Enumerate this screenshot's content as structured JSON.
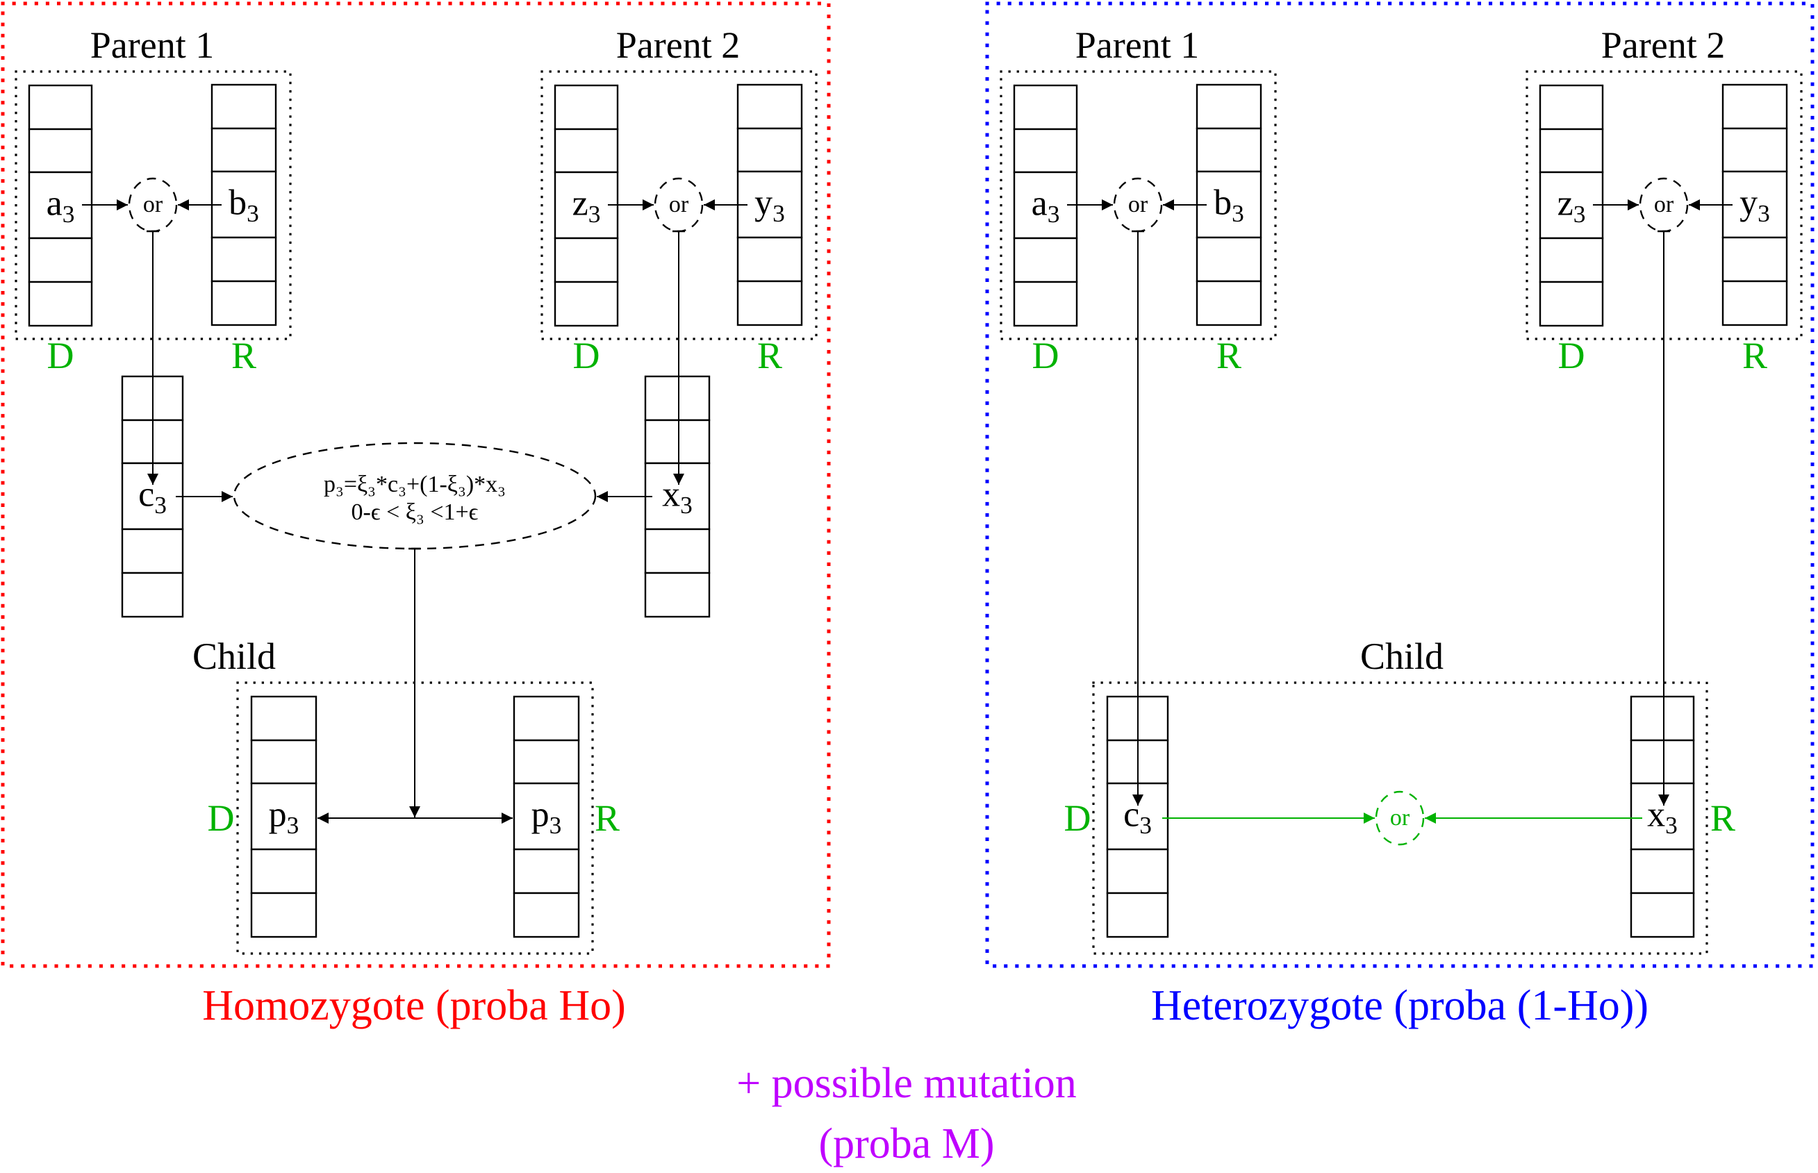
{
  "colors": {
    "homozygote": "#ff0000",
    "heterozygote": "#0000ff",
    "allele_label": "#00b200",
    "mutation": "#bf00ff",
    "ink": "#000000"
  },
  "panels": [
    {
      "id": "homozygote",
      "caption": "Homozygote (proba Ho)",
      "parents": [
        {
          "title": "Parent 1",
          "dominant": {
            "label": "D",
            "gene": "a",
            "sub": "3"
          },
          "recessive": {
            "label": "R",
            "gene": "b",
            "sub": "3"
          },
          "selector": "or"
        },
        {
          "title": "Parent 2",
          "dominant": {
            "label": "D",
            "gene": "z",
            "sub": "3"
          },
          "recessive": {
            "label": "R",
            "gene": "y",
            "sub": "3"
          },
          "selector": "or"
        }
      ],
      "gametes": [
        {
          "gene": "c",
          "sub": "3"
        },
        {
          "gene": "x",
          "sub": "3"
        }
      ],
      "blend": {
        "line1": "p₃=ξ₃*c₃+(1-ξ₃)*x₃",
        "line2": "0-ϵ < ξ₃ <1+ϵ"
      },
      "child": {
        "title": "Child",
        "dominant": {
          "label": "D",
          "gene": "p",
          "sub": "3"
        },
        "recessive": {
          "label": "R",
          "gene": "p",
          "sub": "3"
        }
      }
    },
    {
      "id": "heterozygote",
      "caption": "Heterozygote (proba (1-Ho))",
      "parents": [
        {
          "title": "Parent 1",
          "dominant": {
            "label": "D",
            "gene": "a",
            "sub": "3"
          },
          "recessive": {
            "label": "R",
            "gene": "b",
            "sub": "3"
          },
          "selector": "or"
        },
        {
          "title": "Parent 2",
          "dominant": {
            "label": "D",
            "gene": "z",
            "sub": "3"
          },
          "recessive": {
            "label": "R",
            "gene": "y",
            "sub": "3"
          },
          "selector": "or"
        }
      ],
      "child": {
        "title": "Child",
        "dominant": {
          "label": "D",
          "gene": "c",
          "sub": "3"
        },
        "recessive": {
          "label": "R",
          "gene": "x",
          "sub": "3"
        },
        "selector": "or"
      }
    }
  ],
  "footer": {
    "line1": "+ possible mutation",
    "line2": "(proba M)"
  }
}
